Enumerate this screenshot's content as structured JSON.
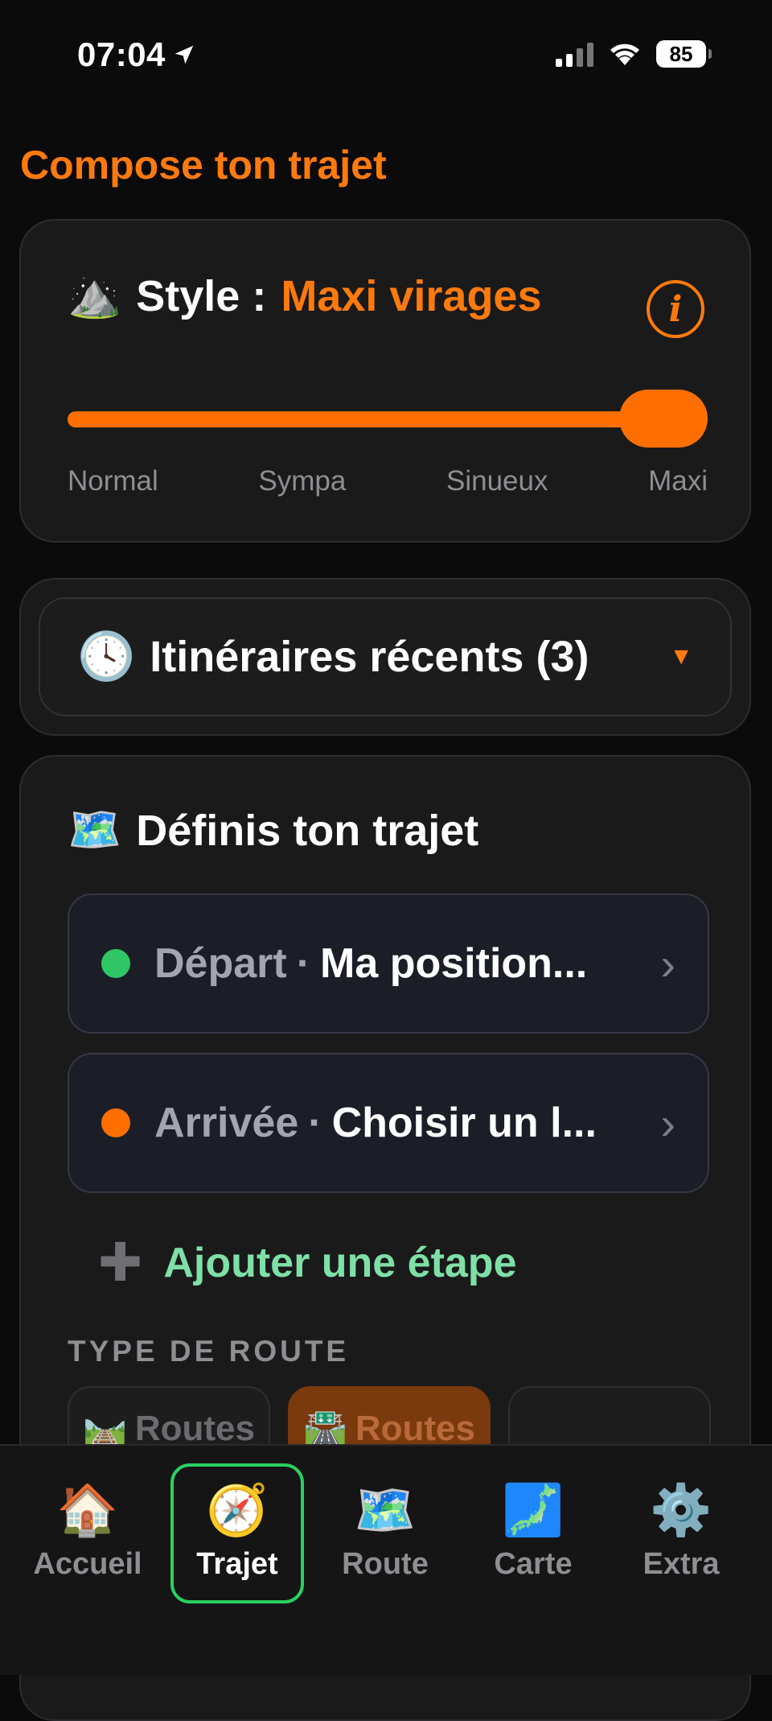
{
  "status_bar": {
    "time": "07:04",
    "battery": "85"
  },
  "page_title": "Compose ton trajet",
  "style_card": {
    "label": "Style :",
    "value": "Maxi virages",
    "icon": "mountain-emoji",
    "slider": {
      "labels": [
        "Normal",
        "Sympa",
        "Sinueux",
        "Maxi"
      ],
      "selected_index": 3,
      "level": 1.0
    }
  },
  "recent": {
    "label": "Itinéraires récents (3)",
    "icon": "clock-emoji"
  },
  "define": {
    "title": "Définis ton trajet",
    "icon": "map-emoji",
    "start": {
      "name": "Départ",
      "value": "Ma position...",
      "color": "#2fc766"
    },
    "end": {
      "name": "Arrivée",
      "value": "Choisir un l...",
      "color": "#ff6f00"
    },
    "add_step": "Ajouter une étape",
    "route_type_label": "TYPE DE ROUTE",
    "route_types": [
      {
        "label": "Routes",
        "active": false
      },
      {
        "label": "Routes",
        "active": true
      },
      {
        "label": "",
        "active": false
      }
    ]
  },
  "tabs": [
    {
      "label": "Accueil",
      "icon": "house-emoji",
      "active": false
    },
    {
      "label": "Trajet",
      "icon": "compass-emoji",
      "active": true
    },
    {
      "label": "Route",
      "icon": "map-emoji",
      "active": false
    },
    {
      "label": "Carte",
      "icon": "japan-map-emoji",
      "active": false
    },
    {
      "label": "Extra",
      "icon": "gear-emoji",
      "active": false
    }
  ],
  "colors": {
    "accent": "#ff7a0c",
    "success": "#2bd05f",
    "add_step": "#7ee0a6"
  }
}
